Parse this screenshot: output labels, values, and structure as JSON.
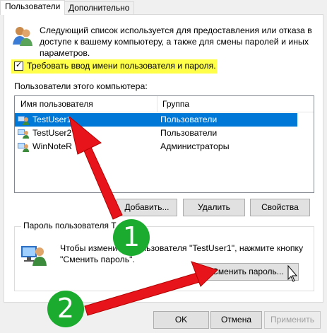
{
  "tabs": [
    "Пользователи",
    "Дополнительно"
  ],
  "intro_text": "Следующий список используется для предоставления или отказа в доступе к вашему компьютеру, а также для смены паролей и иных параметров.",
  "require_login": {
    "label": "Требовать ввод имени пользователя и пароля.",
    "checked": true
  },
  "users_section_label": "Пользователи этого компьютера:",
  "table": {
    "columns": [
      "Имя пользователя",
      "Группа"
    ],
    "rows": [
      {
        "name": "TestUser1",
        "group": "Пользователи",
        "selected": true
      },
      {
        "name": "TestUser2",
        "group": "Пользователи",
        "selected": false
      },
      {
        "name": "WinNoteR",
        "group": "Администраторы",
        "selected": false
      }
    ]
  },
  "buttons": {
    "add": "Добавить...",
    "remove": "Удалить",
    "properties": "Свойства",
    "change_password": "Сменить пароль...",
    "ok": "OK",
    "cancel": "Отмена",
    "apply": "Применить"
  },
  "password_group": {
    "title": "Пароль пользователя T",
    "text": "Чтобы измени ль пользователя \"TestUser1\", нажмите кнопку \"Сменить пароль\"."
  },
  "annotations": {
    "step1": "1",
    "step2": "2"
  },
  "colors": {
    "selection": "#0078d7",
    "highlight": "#ffff4a",
    "arrow": "#e8141b",
    "badge": "#1bab2f"
  }
}
